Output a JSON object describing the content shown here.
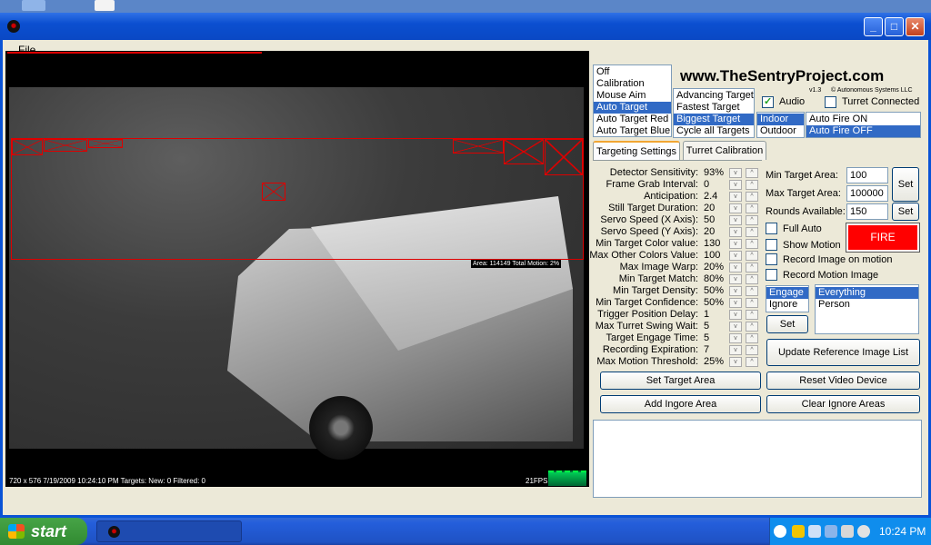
{
  "window": {
    "title": ""
  },
  "menu": {
    "file": "File"
  },
  "video": {
    "area_label": "Area: 114149  Total Motion: 2%",
    "footer": "720 x 576    7/19/2009 10:24:10 PM    Targets: New: 0 Filtered: 0",
    "fps": "21FPS"
  },
  "header": {
    "site": "www.TheSentryProject.com",
    "version": "v1.3",
    "copyright": "© Autonomous Systems LLC"
  },
  "modes": {
    "items": [
      "Off",
      "Calibration",
      "Mouse Aim",
      "Auto Target",
      "Auto Target Red",
      "Auto Target Blue"
    ],
    "selected": "Auto Target"
  },
  "target_selection": {
    "items": [
      "Advancing Target",
      "Fastest Target",
      "Biggest Target",
      "Cycle all Targets"
    ],
    "selected": "Biggest Target"
  },
  "environment": {
    "items": [
      "Indoor",
      "Outdoor"
    ],
    "selected": "Indoor"
  },
  "autofire": {
    "items": [
      "Auto Fire ON",
      "Auto Fire OFF"
    ],
    "selected": "Auto Fire OFF"
  },
  "checks": {
    "audio": {
      "label": "Audio",
      "checked": true
    },
    "turret_connected": {
      "label": "Turret Connected",
      "checked": false
    },
    "full_auto": {
      "label": "Full Auto",
      "checked": false
    },
    "show_motion": {
      "label": "Show Motion",
      "checked": false
    },
    "record_image_motion": {
      "label": "Record Image on motion",
      "checked": false
    },
    "record_motion_image": {
      "label": "Record Motion Image",
      "checked": false
    }
  },
  "tabs": [
    {
      "label": "Targeting Settings",
      "active": true
    },
    {
      "label": "Turret Calibration",
      "active": false
    }
  ],
  "settings": [
    {
      "label": "Detector Sensitivity:",
      "value": "93%"
    },
    {
      "label": "Frame Grab Interval:",
      "value": "0"
    },
    {
      "label": "Anticipation:",
      "value": "2.4"
    },
    {
      "label": "Still Target Duration:",
      "value": "20"
    },
    {
      "label": "Servo Speed (X Axis):",
      "value": "50"
    },
    {
      "label": "Servo Speed (Y Axis):",
      "value": "20"
    },
    {
      "label": "Min Target Color value:",
      "value": "130"
    },
    {
      "label": "Max Other Colors Value:",
      "value": "100"
    },
    {
      "label": "Max Image Warp:",
      "value": "20%"
    },
    {
      "label": "Min Target Match:",
      "value": "80%"
    },
    {
      "label": "Min Target Density:",
      "value": "50%"
    },
    {
      "label": "Min Target Confidence:",
      "value": "50%"
    },
    {
      "label": "Trigger Position Delay:",
      "value": "1"
    },
    {
      "label": "Max Turret Swing Wait:",
      "value": "5"
    },
    {
      "label": "Target Engage Time:",
      "value": "5"
    },
    {
      "label": "Recording Expiration:",
      "value": "7"
    },
    {
      "label": "Max Motion Threshold:",
      "value": "25%"
    }
  ],
  "spin": {
    "down": "v",
    "up": "^"
  },
  "inputs": {
    "min_target_area": {
      "label": "Min Target Area:",
      "value": "100"
    },
    "max_target_area": {
      "label": "Max Target Area:",
      "value": "100000"
    },
    "rounds_available": {
      "label": "Rounds Available:",
      "value": "150"
    }
  },
  "buttons": {
    "set_area": "Set",
    "set_rounds": "Set",
    "fire": "FIRE",
    "set_class": "Set",
    "update_reference": "Update Reference Image List",
    "set_target_area": "Set Target Area",
    "reset_video": "Reset Video Device",
    "add_ignore": "Add Ingore Area",
    "clear_ignore": "Clear Ignore Areas"
  },
  "engage": {
    "items": [
      "Engage",
      "Ignore"
    ],
    "selected": "Engage"
  },
  "classes": {
    "items": [
      "Everything",
      "Person"
    ],
    "selected": "Everything"
  },
  "taskbar": {
    "start": "start",
    "clock": "10:24 PM"
  },
  "colors": {
    "selection": "#316ac5",
    "fire": "#ff0000",
    "motion": "#dd0000"
  }
}
